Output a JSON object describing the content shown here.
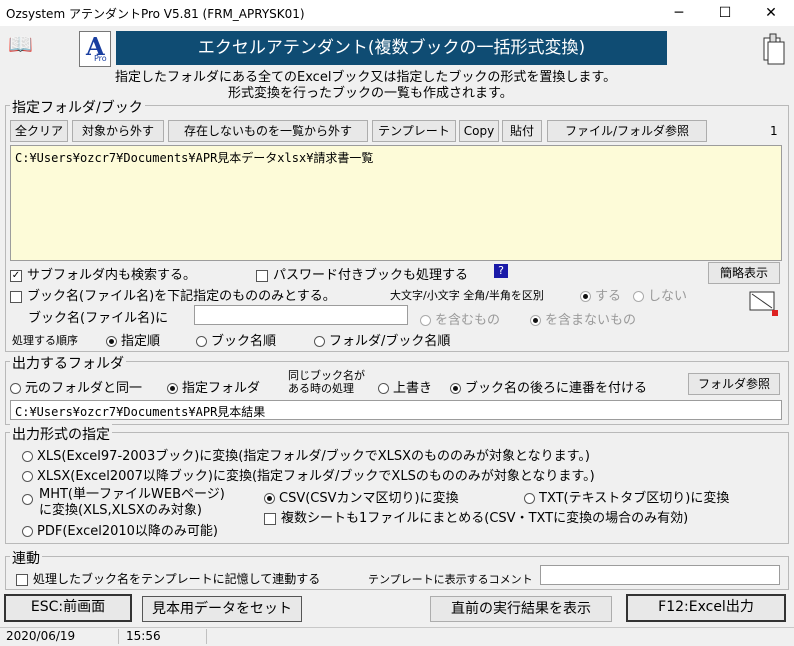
{
  "window": {
    "title": "Ozsystem アテンダントPro V5.81 (FRM_APRYSK01)"
  },
  "banner": {
    "logo_letter": "A",
    "logo_sub": "Pro",
    "title": "エクセルアテンダント(複数ブックの一括形式変換)"
  },
  "description": {
    "line1": "指定したフォルダにある全てのExcelブック又は指定したブックの形式を置換します。",
    "line2": "形式変換を行ったブックの一覧も作成されます。"
  },
  "folder_group": {
    "title": "指定フォルダ/ブック",
    "buttons": [
      "全クリア",
      "対象から外す",
      "存在しないものを一覧から外す",
      "テンプレート",
      "Copy",
      "貼付",
      "ファイル/フォルダ参照"
    ],
    "count": "1",
    "paths": [
      "C:¥Users¥ozcr7¥Documents¥APR見本データxlsx¥請求書一覧"
    ],
    "subfolder_label": "サブフォルダ内も検索する。",
    "password_label": "パスワード付きブックも処理する",
    "help_mark": "?",
    "abbrev_button": "簡略表示",
    "bookname_only_label": "ブック名(ファイル名)を下記指定のもののみとする。",
    "case_label": "大文字/小文字 全角/半角を区別",
    "case_yes": "する",
    "case_no": "しない",
    "bookname_input_label": "ブック名(ファイル名)に",
    "bookname_input_value": "",
    "include_label": "を含むもの",
    "exclude_label": "を含まないもの",
    "order_label": "処理する順序",
    "order_options": [
      "指定順",
      "ブック名順",
      "フォルダ/ブック名順"
    ]
  },
  "output_folder": {
    "title": "出力するフォルダ",
    "same_label": "元のフォルダと同一",
    "specified_label": "指定フォルダ",
    "dup_label_1": "同じブック名が",
    "dup_label_2": "ある時の処理",
    "overwrite_label": "上書き",
    "sequence_label": "ブック名の後ろに連番を付ける",
    "browse_button": "フォルダ参照",
    "path": "C:¥Users¥ozcr7¥Documents¥APR見本結果"
  },
  "output_format": {
    "title": "出力形式の指定",
    "xls": "XLS(Excel97-2003ブック)に変換(指定フォルダ/ブックでXLSXのもののみが対象となります。)",
    "xlsx": "XLSX(Excel2007以降ブック)に変換(指定フォルダ/ブックでXLSのもののみが対象となります。)",
    "mht_1": "MHT(単一ファイルWEBページ)",
    "mht_2": "に変換(XLS,XLSXのみ対象)",
    "csv": "CSV(CSVカンマ区切り)に変換",
    "txt": "TXT(テキストタブ区切り)に変換",
    "multi_sheet": "複数シートも1ファイルにまとめる(CSV・TXTに変換の場合のみ有効)",
    "pdf": "PDF(Excel2010以降のみ可能)"
  },
  "link_group": {
    "title": "連動",
    "remember_label": "処理したブック名をテンプレートに記憶して連動する",
    "comment_label": "テンプレートに表示するコメント",
    "comment_value": ""
  },
  "footer": {
    "esc_button": "ESC:前画面",
    "sample_button": "見本用データをセット",
    "last_result_button": "直前の実行結果を表示",
    "f12_button": "F12:Excel出力"
  },
  "status": {
    "date": "2020/06/19",
    "time": "15:56"
  }
}
